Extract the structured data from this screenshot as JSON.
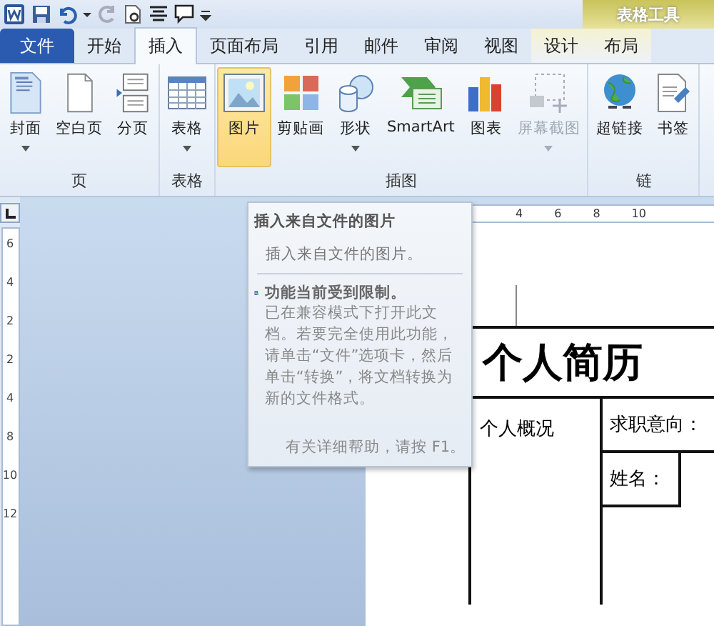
{
  "contextual_group": {
    "title": "表格工具"
  },
  "tabs": [
    {
      "label": "文件",
      "kind": "file",
      "selected": false
    },
    {
      "label": "开始",
      "kind": "main",
      "selected": false
    },
    {
      "label": "插入",
      "kind": "main",
      "selected": true
    },
    {
      "label": "页面布局",
      "kind": "main",
      "selected": false
    },
    {
      "label": "引用",
      "kind": "main",
      "selected": false
    },
    {
      "label": "邮件",
      "kind": "main",
      "selected": false
    },
    {
      "label": "审阅",
      "kind": "main",
      "selected": false
    },
    {
      "label": "视图",
      "kind": "main",
      "selected": false
    },
    {
      "label": "设计",
      "kind": "contextual",
      "selected": false
    },
    {
      "label": "布局",
      "kind": "contextual",
      "selected": false
    }
  ],
  "ribbon_groups": [
    {
      "label": "页",
      "buttons": [
        {
          "label": "封面",
          "dropdown": true,
          "selected": false,
          "disabled": false
        },
        {
          "label": "空白页",
          "dropdown": false,
          "selected": false,
          "disabled": false
        },
        {
          "label": "分页",
          "dropdown": false,
          "selected": false,
          "disabled": false
        }
      ]
    },
    {
      "label": "表格",
      "buttons": [
        {
          "label": "表格",
          "dropdown": true,
          "selected": false,
          "disabled": false
        }
      ]
    },
    {
      "label": "插图",
      "buttons": [
        {
          "label": "图片",
          "dropdown": false,
          "selected": true,
          "disabled": false
        },
        {
          "label": "剪贴画",
          "dropdown": false,
          "selected": false,
          "disabled": false
        },
        {
          "label": "形状",
          "dropdown": true,
          "selected": false,
          "disabled": false
        },
        {
          "label": "SmartArt",
          "dropdown": false,
          "selected": false,
          "disabled": false
        },
        {
          "label": "图表",
          "dropdown": false,
          "selected": false,
          "disabled": false
        },
        {
          "label": "屏幕截图",
          "dropdown": true,
          "selected": false,
          "disabled": true
        }
      ]
    },
    {
      "label": "链",
      "buttons": [
        {
          "label": "超链接",
          "dropdown": false,
          "selected": false,
          "disabled": false
        },
        {
          "label": "书签",
          "dropdown": false,
          "selected": false,
          "disabled": false
        }
      ]
    }
  ],
  "ruler": {
    "horizontal": [
      "4",
      "6",
      "8",
      "10"
    ],
    "vertical": [
      "6",
      "4",
      "2",
      "2",
      "4",
      "8",
      "10",
      "12"
    ]
  },
  "tooltip": {
    "title": "插入来自文件的图片",
    "description": "插入来自文件的图片。",
    "warning_title": "功能当前受到限制。",
    "warning_text": "已在兼容模式下打开此文档。若要完全使用此功能，请单击“文件”选项卡，然后单击“转换”，将文档转换为新的文件格式。",
    "help": "有关详细帮助，请按 F1。"
  },
  "document": {
    "heading": "个人简历",
    "section": "个人概况",
    "fields": [
      {
        "label": "求职意向："
      },
      {
        "label": "姓名："
      }
    ]
  }
}
